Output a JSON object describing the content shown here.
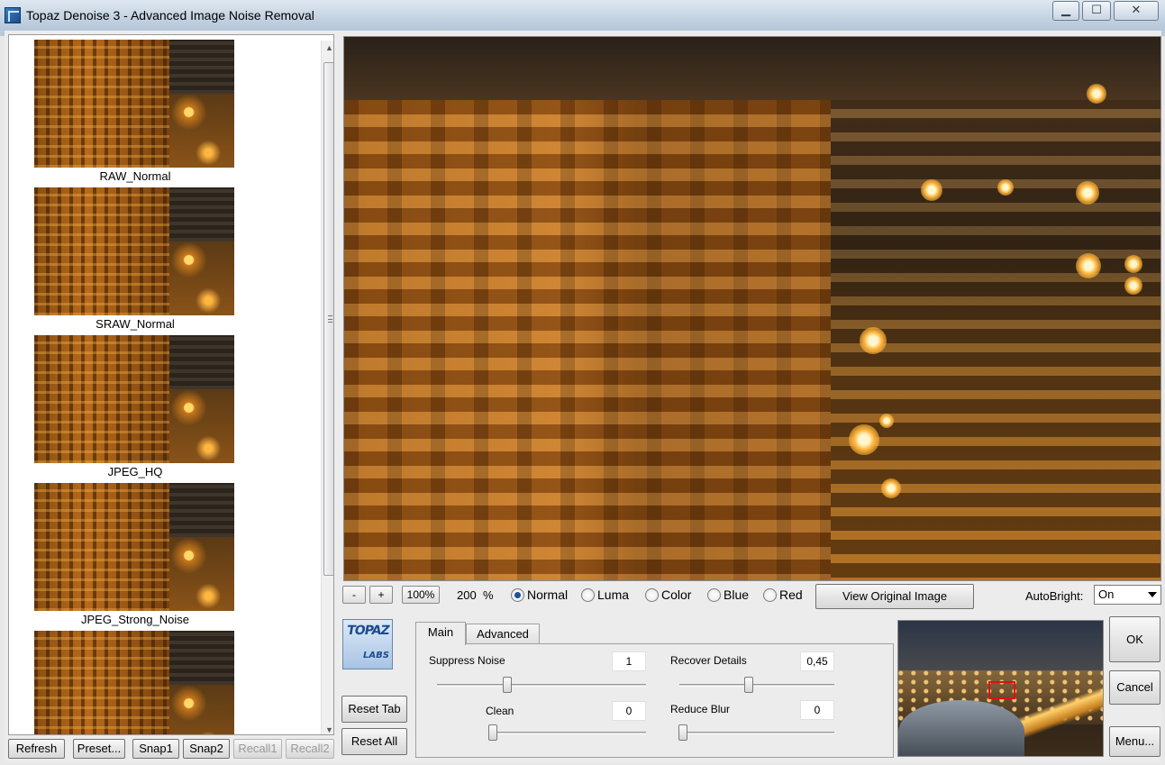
{
  "window": {
    "title": "Topaz Denoise 3 - Advanced Image Noise Removal",
    "minimize": "▁",
    "maximize": "☐",
    "close": "✕"
  },
  "presets": [
    {
      "label": "RAW_Normal"
    },
    {
      "label": "SRAW_Normal"
    },
    {
      "label": "JPEG_HQ"
    },
    {
      "label": "JPEG_Strong_Noise"
    },
    {
      "label": ""
    }
  ],
  "scroll": {
    "up": "▲",
    "down": "▼"
  },
  "bottom_buttons": {
    "refresh": "Refresh",
    "preset": "Preset...",
    "snap1": "Snap1",
    "snap2": "Snap2",
    "recall1": "Recall1",
    "recall2": "Recall2"
  },
  "zoom_toolbar": {
    "minus": "-",
    "plus": "+",
    "hundred": "100%",
    "zoom_value": "200",
    "zoom_unit": "%",
    "modes": [
      "Normal",
      "Luma",
      "Color",
      "Blue",
      "Red"
    ],
    "selected_mode": "Normal",
    "view_original": "View Original Image",
    "autobright_label": "AutoBright:",
    "autobright_value": "On"
  },
  "logo": {
    "top": "TOPAZ",
    "bottom": "LABS"
  },
  "left_buttons": {
    "reset_tab": "Reset Tab",
    "reset_all": "Reset All"
  },
  "tabs": [
    {
      "label": "Main",
      "active": true
    },
    {
      "label": "Advanced",
      "active": false
    }
  ],
  "params": {
    "suppress_noise": {
      "label": "Suppress Noise",
      "value": "1"
    },
    "clean": {
      "label": "Clean",
      "value": "0"
    },
    "recover_details": {
      "label": "Recover Details",
      "value": "0,45"
    },
    "reduce_blur": {
      "label": "Reduce Blur",
      "value": "0"
    }
  },
  "right_buttons": {
    "ok": "OK",
    "cancel": "Cancel",
    "menu": "Menu..."
  }
}
